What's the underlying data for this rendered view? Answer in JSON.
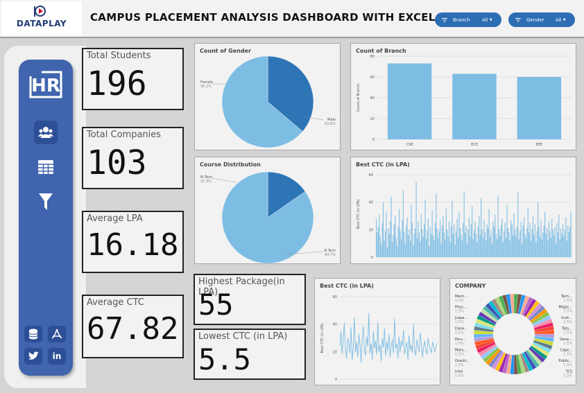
{
  "header": {
    "logo_text": "DATAPLAY",
    "title": "CAMPUS PLACEMENT ANALYSIS DASHBOARD WITH EXCEL",
    "slicers": [
      {
        "label": "Branch",
        "value": "All"
      },
      {
        "label": "Gender",
        "value": "All"
      }
    ]
  },
  "sidebar": {
    "logo": "HR",
    "items": [
      {
        "icon": "users-icon"
      },
      {
        "icon": "table-icon"
      },
      {
        "icon": "filter-icon"
      }
    ],
    "bottom": [
      {
        "icon": "database-icon"
      },
      {
        "icon": "pdf-icon"
      },
      {
        "icon": "twitter-icon"
      },
      {
        "icon": "linkedin-icon",
        "text": "in"
      }
    ]
  },
  "kpis": {
    "total_students": {
      "label": "Total Students",
      "value": "196"
    },
    "total_companies": {
      "label": "Total Companies",
      "value": "103"
    },
    "average_lpa": {
      "label": "Average LPA",
      "value": "16.18"
    },
    "average_ctc": {
      "label": "Average CTC",
      "value": "67.82"
    },
    "highest_package": {
      "label": "Highest Package(in LPA)",
      "value": "55"
    },
    "lowest_ctc": {
      "label": "Lowest CTC (in LPA)",
      "value": "5.5"
    }
  },
  "chart_data": [
    {
      "id": "gender",
      "type": "pie",
      "title": "Count of Gender",
      "labels": [
        "Female",
        "Male"
      ],
      "values": [
        36.2,
        63.8
      ],
      "value_labels": [
        "36.2%",
        "63.8%"
      ],
      "colors": [
        "#2e75b6",
        "#7dbde4"
      ]
    },
    {
      "id": "branch",
      "type": "bar",
      "title": "Count of Branch",
      "categories": [
        "CSE",
        "ECE",
        "EEE"
      ],
      "values": [
        73,
        63,
        60
      ],
      "ylabel": "Count of Branch",
      "ylim": [
        0,
        80
      ],
      "yticks": [
        0,
        20,
        40,
        60,
        80
      ],
      "color": "#7dbde4"
    },
    {
      "id": "course",
      "type": "pie",
      "title": "Course Distribution",
      "labels": [
        "M.Tech",
        "B.Tech"
      ],
      "values": [
        15.3,
        84.7
      ],
      "value_labels": [
        "15.3%",
        "84.7%"
      ],
      "colors": [
        "#2e75b6",
        "#7dbde4"
      ]
    },
    {
      "id": "best_ctc_bar",
      "type": "bar",
      "title": "Best CTC (in LPA)",
      "ylabel": "Best CTC (in LPA)",
      "ylim": [
        0,
        60
      ],
      "yticks": [
        0,
        20,
        40,
        60
      ],
      "color": "#7dbde4",
      "values": [
        28,
        18,
        22,
        31,
        15,
        9,
        25,
        40,
        12,
        19,
        33,
        7,
        21,
        17,
        26,
        44,
        11,
        16,
        24,
        30,
        14,
        8,
        22,
        35,
        19,
        13,
        27,
        49,
        18,
        10,
        23,
        29,
        16,
        20,
        12,
        38,
        25,
        9,
        17,
        21,
        55,
        14,
        26,
        18,
        11,
        31,
        20,
        15,
        24,
        42,
        13,
        19,
        28,
        8,
        22,
        17,
        34,
        16,
        12,
        25,
        46,
        21,
        14,
        19,
        27,
        10,
        23,
        30,
        18,
        13,
        36,
        20,
        15,
        26,
        11,
        22,
        41,
        17,
        24,
        9,
        19,
        28,
        14,
        33,
        21,
        16,
        12,
        25,
        48,
        18,
        23,
        10,
        20,
        29,
        15,
        24,
        37,
        13,
        19,
        26,
        17,
        11,
        22,
        30,
        16,
        43,
        20,
        14,
        27,
        18,
        12,
        24,
        21,
        35,
        15,
        19,
        10,
        26,
        22,
        31,
        17,
        13,
        45,
        20,
        16,
        23,
        28,
        11,
        19,
        25,
        14,
        38,
        21,
        18,
        12,
        27,
        24,
        16,
        32,
        20,
        15,
        22,
        47,
        13,
        19,
        26,
        10,
        23,
        29,
        17,
        14,
        21,
        36,
        18,
        25,
        12,
        20,
        30,
        16,
        24,
        11,
        19,
        40,
        22,
        15,
        27,
        13,
        18,
        23,
        33,
        17,
        21,
        12,
        26,
        19,
        14,
        28,
        20,
        16,
        22,
        10,
        25,
        18,
        31,
        13,
        21,
        17,
        24,
        15,
        20,
        29,
        12,
        23,
        18,
        22,
        33
      ]
    },
    {
      "id": "best_ctc_line",
      "type": "line",
      "title": "Best CTC (in LPA)",
      "ylabel": "Best CTC (in LPA)",
      "ylim": [
        0,
        60
      ],
      "yticks": [
        0,
        20,
        40,
        60
      ],
      "color": "#7dbde4",
      "values": [
        24,
        35,
        18,
        28,
        41,
        22,
        15,
        30,
        26,
        19,
        38,
        14,
        23,
        45,
        20,
        27,
        16,
        33,
        25,
        12,
        29,
        39,
        21,
        17,
        31,
        24,
        48,
        19,
        26,
        14,
        35,
        22,
        28,
        18,
        42,
        20,
        25,
        13,
        30,
        23,
        37,
        17,
        27,
        21,
        33,
        16,
        24,
        29,
        19,
        44,
        22,
        26,
        15,
        31,
        20,
        28,
        24,
        36,
        18,
        23,
        27,
        14,
        32,
        21,
        25,
        19,
        40,
        22,
        17,
        29,
        24,
        20,
        34,
        26,
        16,
        23,
        28,
        21,
        18,
        30,
        25,
        22,
        19,
        27,
        24,
        20,
        23,
        26
      ]
    },
    {
      "id": "company",
      "type": "pie",
      "title": "COMPANY",
      "left_labels": [
        "Mech...",
        "Phys...",
        "Juspa...",
        "Darw...",
        "Parv...",
        "Marv...",
        "Orackl...",
        "Intel"
      ],
      "right_labels": [
        "Tech...",
        "Magic...",
        "Inuit...",
        "Tata...",
        "Genp...",
        "Cape...",
        "Public...",
        "TCS"
      ],
      "slice_label": "1.5%"
    }
  ]
}
